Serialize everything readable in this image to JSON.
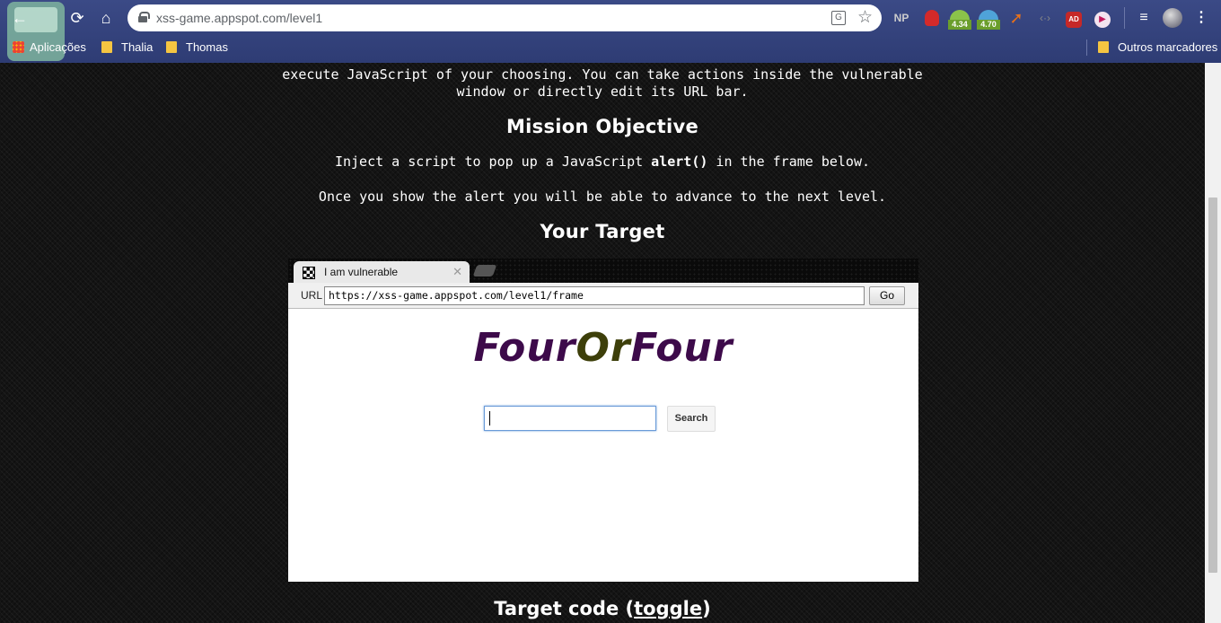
{
  "browser": {
    "url": "xss-game.appspot.com/level1",
    "extensions": [
      "NP",
      "4.34",
      "4.70",
      "AD"
    ],
    "bookmarks": {
      "apps": "Aplicações",
      "items": [
        "Thalia",
        "Thomas"
      ],
      "other": "Outros marcadores"
    }
  },
  "page": {
    "intro_line1": "execute JavaScript of your choosing. You can take actions inside the vulnerable",
    "intro_line2": "window or directly edit its URL bar.",
    "mission_heading": "Mission Objective",
    "objective_before": "Inject a script to pop up a JavaScript ",
    "objective_code": "alert()",
    "objective_after": " in the frame below.",
    "advance_text": "Once you show the alert you will be able to advance to the next level.",
    "target_heading": "Your Target",
    "target_code_label": "Target code (",
    "target_code_link": "toggle",
    "target_code_close": ")"
  },
  "target_frame": {
    "tab_title": "I am vulnerable",
    "url_label": "URL",
    "url_value": "https://xss-game.appspot.com/level1/frame",
    "go_label": "Go",
    "logo_part1": "Four",
    "logo_part2": "Or",
    "logo_part3": "Four",
    "search_value": "",
    "search_button": "Search"
  }
}
